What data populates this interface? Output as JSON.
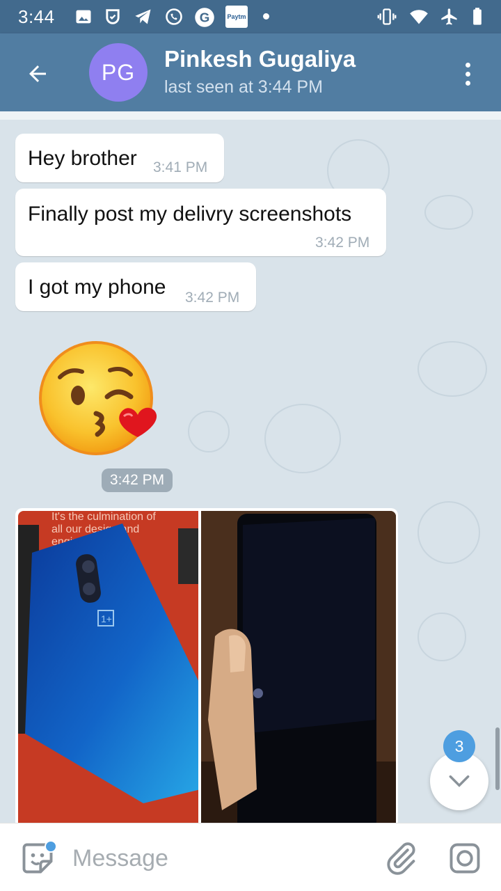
{
  "status_bar": {
    "time": "3:44",
    "icons": [
      "image-icon",
      "paytm-shield-icon",
      "telegram-icon",
      "whatsapp-icon",
      "google-icon",
      "paytm-icon",
      "dot-icon",
      "vibrate-icon",
      "wifi-icon",
      "airplane-icon",
      "battery-icon"
    ],
    "paytm_label": "Paytm"
  },
  "header": {
    "contact_name": "Pinkesh Gugaliya",
    "status": "last seen at 3:44 PM",
    "avatar_initials": "PG",
    "avatar_color": "#8f7ff0",
    "bar_color": "#517da2"
  },
  "messages": [
    {
      "text": "Hey brother",
      "time": "3:41 PM"
    },
    {
      "text": "Finally post my delivry screenshots",
      "time": "3:42 PM"
    },
    {
      "text": "I got my phone",
      "time": "3:42 PM"
    }
  ],
  "emoji_message": {
    "emoji": "face-blowing-a-kiss",
    "time": "3:42 PM"
  },
  "photo_album": {
    "box_text": "It's the culmination of all our design and engineering",
    "photos": [
      "oneplus-phone-back",
      "phone-front-dark"
    ]
  },
  "scroll_down": {
    "unread_count": "3"
  },
  "input": {
    "placeholder": "Message"
  }
}
